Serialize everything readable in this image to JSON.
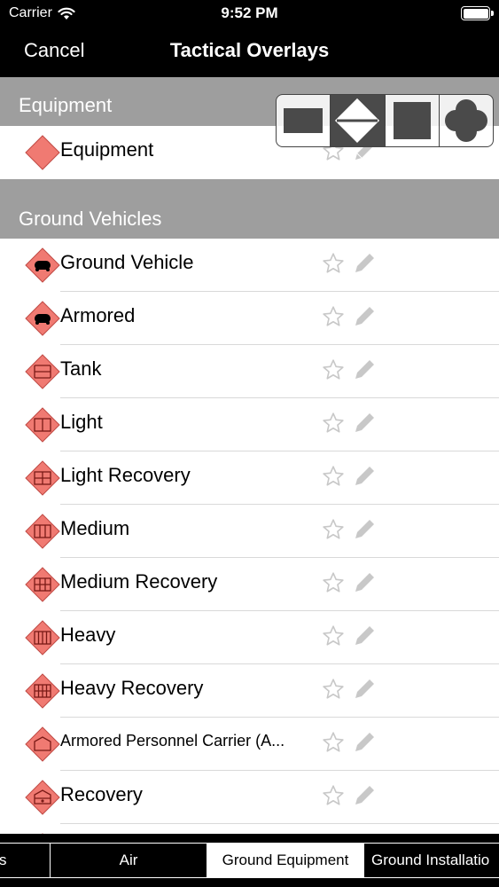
{
  "status": {
    "carrier": "Carrier",
    "time": "9:52 PM"
  },
  "nav": {
    "cancel": "Cancel",
    "title": "Tactical Overlays"
  },
  "sections": [
    {
      "title": "Equipment"
    },
    {
      "title": "Ground Vehicles"
    }
  ],
  "equipment_rows": [
    {
      "label": "Equipment"
    }
  ],
  "vehicle_rows": [
    {
      "label": "Ground Vehicle",
      "icon": "ground-vehicle-symbol-icon"
    },
    {
      "label": "Armored",
      "icon": "armored-symbol-icon"
    },
    {
      "label": "Tank",
      "icon": "tank-symbol-icon"
    },
    {
      "label": "Light",
      "icon": "light-symbol-icon"
    },
    {
      "label": "Light Recovery",
      "icon": "light-recovery-symbol-icon"
    },
    {
      "label": "Medium",
      "icon": "medium-symbol-icon"
    },
    {
      "label": "Medium Recovery",
      "icon": "medium-recovery-symbol-icon"
    },
    {
      "label": "Heavy",
      "icon": "heavy-symbol-icon"
    },
    {
      "label": "Heavy Recovery",
      "icon": "heavy-recovery-symbol-icon"
    },
    {
      "label": "Armored Personnel Carrier (A...",
      "icon": "apc-symbol-icon"
    },
    {
      "label": "Recovery",
      "icon": "recovery-symbol-icon"
    }
  ],
  "shape_picker": {
    "options": [
      "rectangle",
      "diamond",
      "square",
      "clover"
    ],
    "selected": "diamond"
  },
  "tabs": [
    {
      "label": "s"
    },
    {
      "label": "Air"
    },
    {
      "label": "Ground Equipment"
    },
    {
      "label": "Ground Installatio"
    }
  ],
  "selected_tab": "Ground Equipment",
  "colors": {
    "symbol_fill": "#f07a72",
    "header_gray": "#9e9e9e",
    "icon_gray": "#c8c8c8"
  }
}
